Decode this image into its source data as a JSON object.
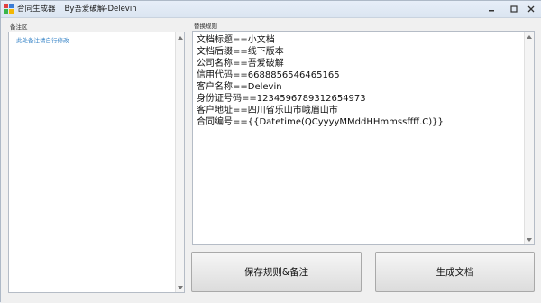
{
  "window": {
    "title": "合同生成器",
    "subtitle": "By吾爱破解-Delevin"
  },
  "left_group": {
    "label": "备注区",
    "hint": "此处备注请自行修改"
  },
  "right_group": {
    "label": "替换规则",
    "rules": [
      "文档标题==小文档",
      "文档后缀==线下版本",
      "公司名称==吾爱破解",
      "信用代码==6688856546465165",
      "客户名称==Delevin",
      "身份证号码==1234596789312654973",
      "客户地址==四川省乐山市峨眉山市",
      "合同编号=={{Datetime(QCyyyyMMddHHmmssffff.C)}}"
    ]
  },
  "buttons": {
    "save": "保存规则&备注",
    "generate": "生成文档"
  },
  "icons": {
    "app": "app-icon",
    "minimize": "minimize-icon",
    "maximize": "maximize-icon",
    "close": "close-icon"
  },
  "colors": {
    "hint_text": "#3a86c8",
    "titlebar": "#dbe5f1"
  }
}
